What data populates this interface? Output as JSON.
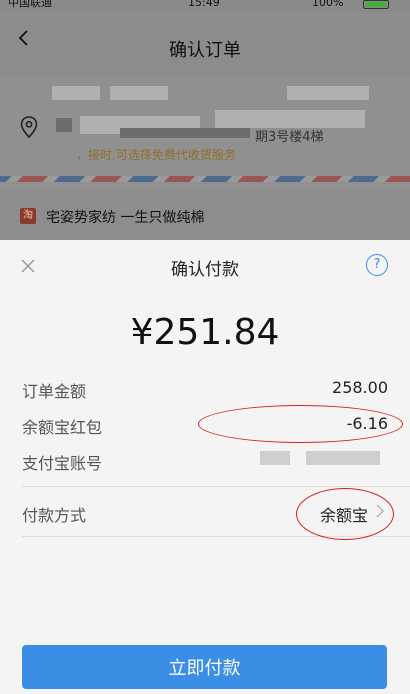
{
  "status_bar": {
    "carrier": "中国联通",
    "time": "15:49",
    "battery": "100%"
  },
  "background_page": {
    "title": "确认订单",
    "address_suffix": "期3号楼4梯",
    "address_tip": "，接时,可选择免费代收货服务",
    "shop_badge": "淘",
    "shop_name": "宅姿势家纺 一生只做纯棉"
  },
  "payment_sheet": {
    "title": "确认付款",
    "help_label": "?",
    "amount": "¥251.84",
    "rows": {
      "order_amount": {
        "label": "订单金额",
        "value": "258.00"
      },
      "red_packet": {
        "label": "余额宝红包",
        "value": "-6.16"
      },
      "account": {
        "label": "支付宝账号"
      },
      "method": {
        "label": "付款方式",
        "value": "余额宝"
      }
    },
    "pay_button": "立即付款"
  },
  "colors": {
    "accent": "#3a8ee6",
    "annotation_red": "#d32222"
  },
  "icons": [
    "back-icon",
    "location-icon",
    "close-icon",
    "help-icon",
    "chevron-right-icon"
  ]
}
